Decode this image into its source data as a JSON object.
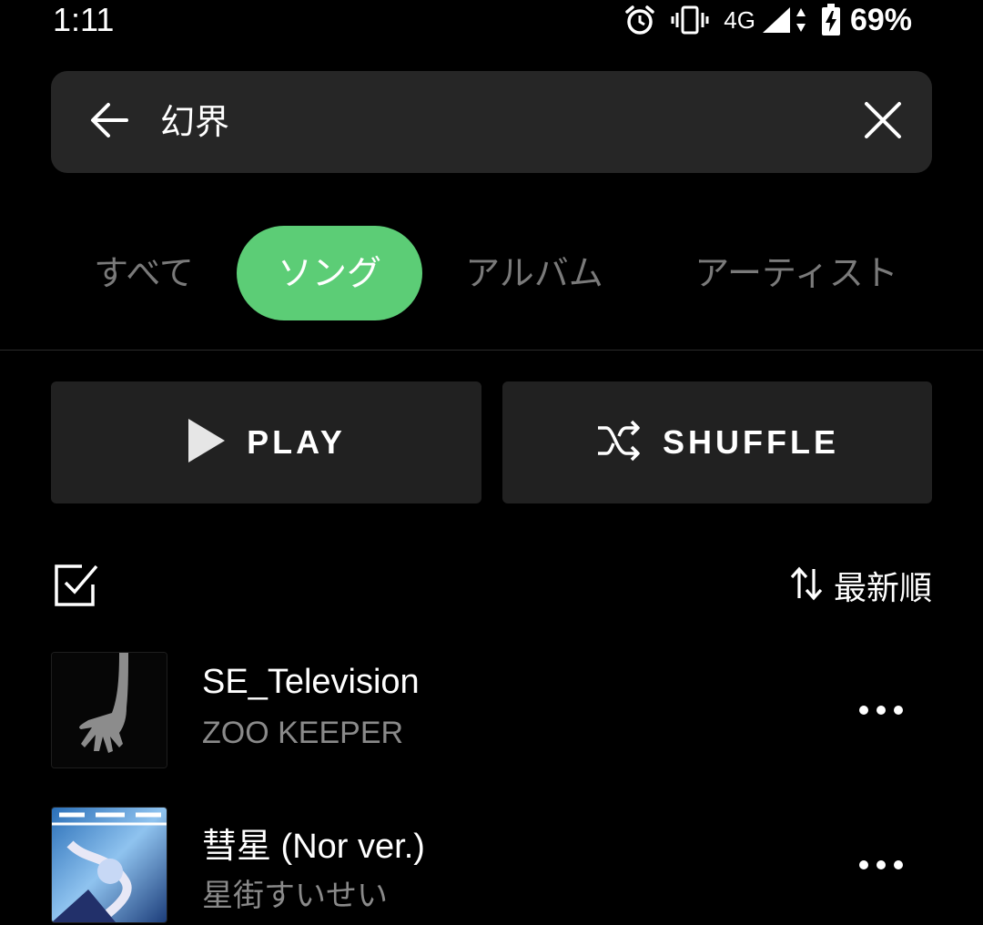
{
  "status_bar": {
    "time": "1:11",
    "network": "4G",
    "battery": "69%",
    "icons": [
      "alarm-icon",
      "vibrate-icon",
      "signal-icon",
      "data-arrows-icon",
      "battery-charging-icon"
    ]
  },
  "search": {
    "query": "幻界",
    "back_icon": "arrow-left-icon",
    "clear_icon": "close-icon"
  },
  "tabs": [
    {
      "label": "すべて",
      "active": false
    },
    {
      "label": "ソング",
      "active": true
    },
    {
      "label": "アルバム",
      "active": false
    },
    {
      "label": "アーティスト",
      "active": false
    }
  ],
  "actions": {
    "play_label": "PLAY",
    "shuffle_label": "SHUFFLE"
  },
  "list_controls": {
    "sort_label": "最新順",
    "select_icon": "checkbox-icon",
    "sort_icon": "sort-arrows-icon"
  },
  "songs": [
    {
      "title": "SE_Television",
      "artist": "ZOO KEEPER"
    },
    {
      "title": "彗星 (Nor ver.)",
      "artist": "星街すいせい"
    }
  ],
  "colors": {
    "background": "#000000",
    "search_bg": "#262626",
    "accent": "#5ccd76",
    "button_bg": "#212121",
    "muted_text": "#7a7a7a"
  }
}
